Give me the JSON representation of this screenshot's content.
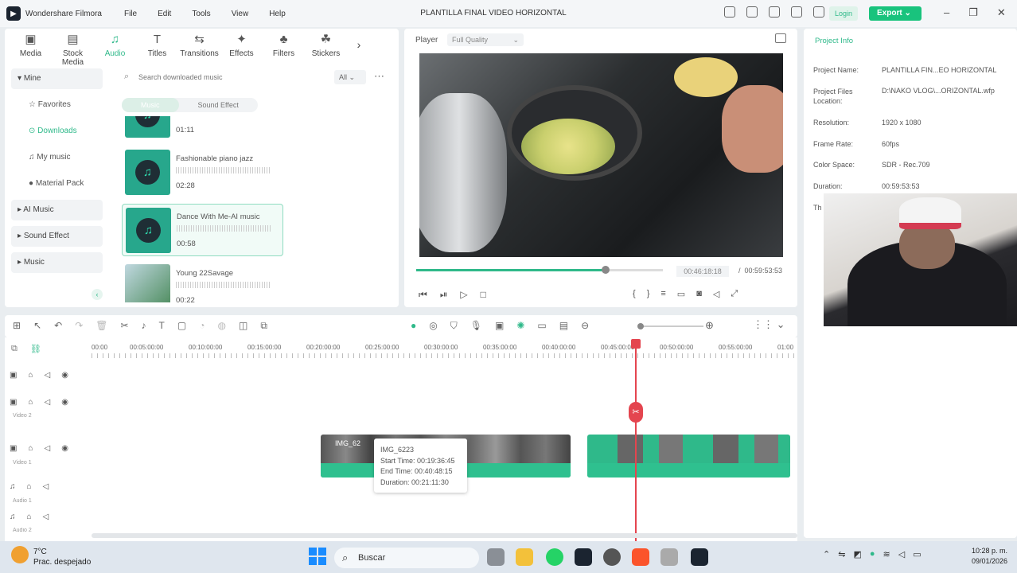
{
  "app": {
    "name": "Wondershare Filmora",
    "title": "PLANTILLA FINAL VIDEO HORIZONTAL"
  },
  "menu": [
    "File",
    "Edit",
    "Tools",
    "View",
    "Help"
  ],
  "header": {
    "login": "Login",
    "export": "Export"
  },
  "library": {
    "tabs": [
      "Media",
      "Stock Media",
      "Audio",
      "Titles",
      "Transitions",
      "Effects",
      "Filters",
      "Stickers"
    ],
    "active_tab": "Audio",
    "sidebar": {
      "mine": "Mine",
      "favorites": "Favorites",
      "downloads": "Downloads",
      "my_music": "My music",
      "material_pack": "Material Pack",
      "ai_music": "AI Music",
      "sound_effect": "Sound Effect",
      "music": "Music"
    },
    "search_placeholder": "Search downloaded music",
    "filter": "All",
    "segments": [
      "Music",
      "Sound Effect"
    ],
    "cards": [
      {
        "title": "",
        "duration": "01:11"
      },
      {
        "title": "Fashionable piano jazz",
        "duration": "02:28"
      },
      {
        "title": "Dance With Me-AI music",
        "duration": "00:58"
      },
      {
        "title": "Young 22Savage",
        "duration": "00:22"
      }
    ]
  },
  "player": {
    "label": "Player",
    "quality": "Full Quality",
    "current": "00:46:18:18",
    "total": "00:59:53:53",
    "progress": 0.77
  },
  "project_info": {
    "tab": "Project Info",
    "rows": [
      {
        "label": "Project Name:",
        "value": "PLANTILLA FIN...EO HORIZONTAL"
      },
      {
        "label": "Project Files Location:",
        "value": "D:\\NAKO VLOG\\...ORIZONTAL.wfp"
      },
      {
        "label": "Resolution:",
        "value": "1920 x 1080"
      },
      {
        "label": "Frame Rate:",
        "value": "60fps"
      },
      {
        "label": "Color Space:",
        "value": "SDR - Rec.709"
      },
      {
        "label": "Duration:",
        "value": "00:59:53:53"
      },
      {
        "label": "Th",
        "value": ""
      }
    ]
  },
  "timeline": {
    "ruler": [
      "00:00",
      "00:05:00:00",
      "00:10:00:00",
      "00:15:00:00",
      "00:20:00:00",
      "00:25:00:00",
      "00:30:00:00",
      "00:35:00:00",
      "00:40:00:00",
      "00:45:00:00",
      "00:50:00:00",
      "00:55:00:00",
      "01:00"
    ],
    "tracks": {
      "video2": "Video 2",
      "video1": "Video 1",
      "audio1": "Audio 1",
      "audio2": "Audio 2"
    },
    "clip_label": "IMG_62",
    "tooltip": {
      "name": "IMG_6223",
      "start": "Start Time: 00:19:36:45",
      "end": "End Time: 00:40:48:15",
      "duration": "Duration: 00:21:11:30"
    }
  },
  "taskbar": {
    "temp": "7°C",
    "weather": "Prac. despejado",
    "search": "Buscar",
    "time": "10:28 p. m.",
    "date": "09/01/2026"
  }
}
